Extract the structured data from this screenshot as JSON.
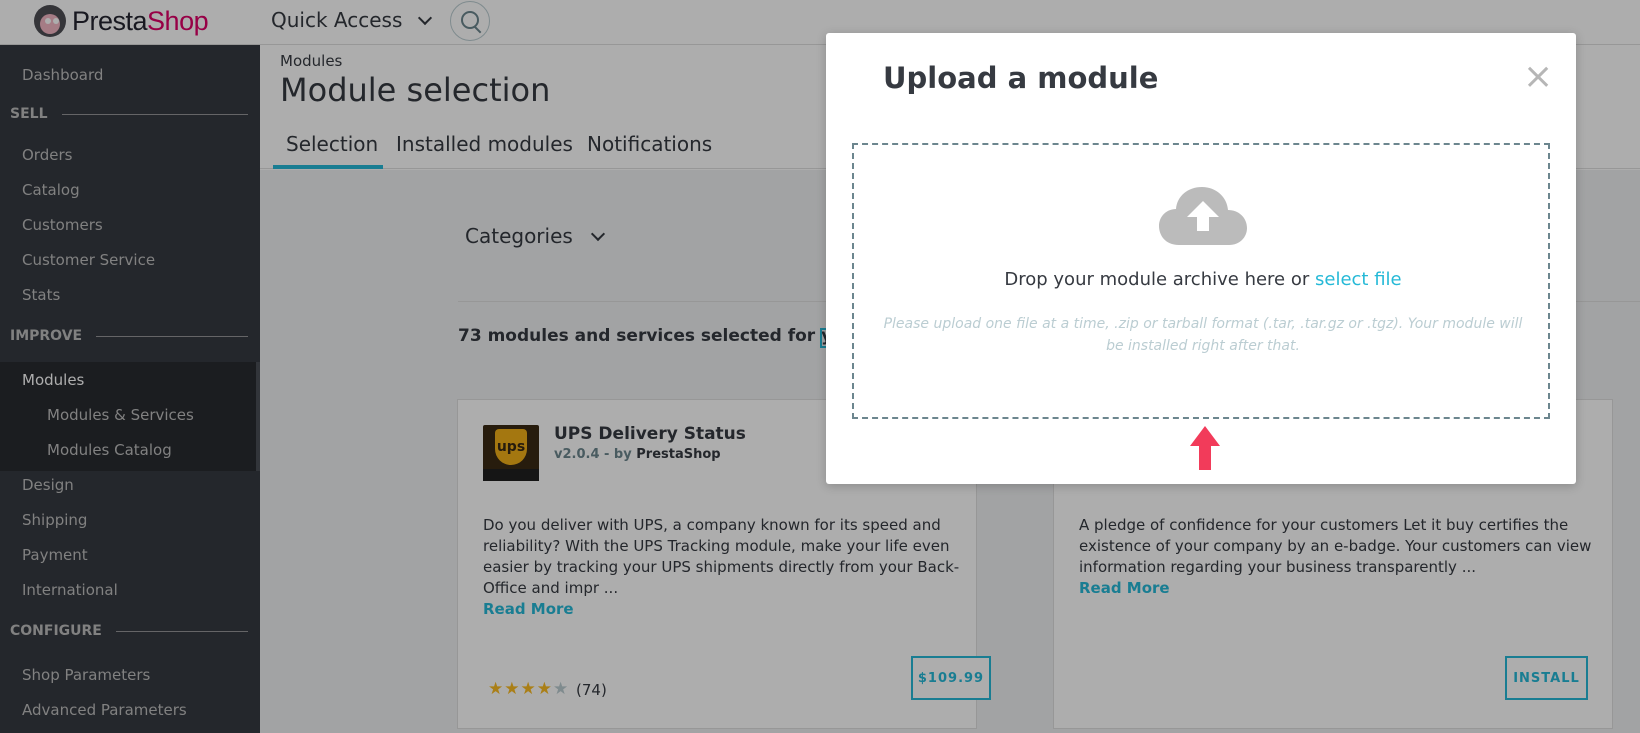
{
  "topbar": {
    "brand_part1": "Presta",
    "brand_part2": "Shop",
    "quick_access": "Quick Access"
  },
  "sidebar": {
    "items": [
      {
        "label": "Dashboard"
      },
      {
        "section": "SELL"
      },
      {
        "label": "Orders"
      },
      {
        "label": "Catalog"
      },
      {
        "label": "Customers"
      },
      {
        "label": "Customer Service"
      },
      {
        "label": "Stats"
      },
      {
        "section": "IMPROVE"
      },
      {
        "label": "Modules"
      },
      {
        "label": "Modules & Services"
      },
      {
        "label": "Modules Catalog"
      },
      {
        "label": "Design"
      },
      {
        "label": "Shipping"
      },
      {
        "label": "Payment"
      },
      {
        "label": "International"
      },
      {
        "section": "CONFIGURE"
      },
      {
        "label": "Shop Parameters"
      },
      {
        "label": "Advanced Parameters"
      }
    ]
  },
  "header": {
    "breadcrumb": "Modules",
    "title": "Module selection",
    "tabs": [
      {
        "label": "Selection"
      },
      {
        "label": "Installed modules"
      },
      {
        "label": "Notifications"
      }
    ]
  },
  "content": {
    "categories_label": "Categories",
    "summary": "73 modules and services selected for you",
    "cards": [
      {
        "title": "UPS Delivery Status",
        "version": "v2.0.4 - by",
        "author": "PrestaShop",
        "logo_text": "ups",
        "description": "Do you deliver with UPS, a company known for its speed and reliability? With the UPS Tracking module, make your life even easier by tracking your UPS shipments directly from your Back-Office and impr ...",
        "read_more": "Read More",
        "rating": 4,
        "rating_count": "(74)",
        "button": "$109.99"
      },
      {
        "description": "A pledge of confidence for your customers Let it buy certifies the existence of your company by an e-badge. Your customers can view information regarding your business transparently ...",
        "read_more": "Read More",
        "button": "INSTALL"
      }
    ]
  },
  "modal": {
    "title": "Upload a module",
    "close": "×",
    "drop_text": "Drop your module archive here or",
    "select_file": "select file",
    "hint": "Please upload one file at a time, .zip or tarball format (.tar, .tar.gz or .tgz). Your module will be installed right after that."
  },
  "colors": {
    "accent": "#25b9d7",
    "sidebar_bg": "#363a41",
    "brand_pink": "#df0067",
    "annotation_arrow": "#f23b5a"
  }
}
